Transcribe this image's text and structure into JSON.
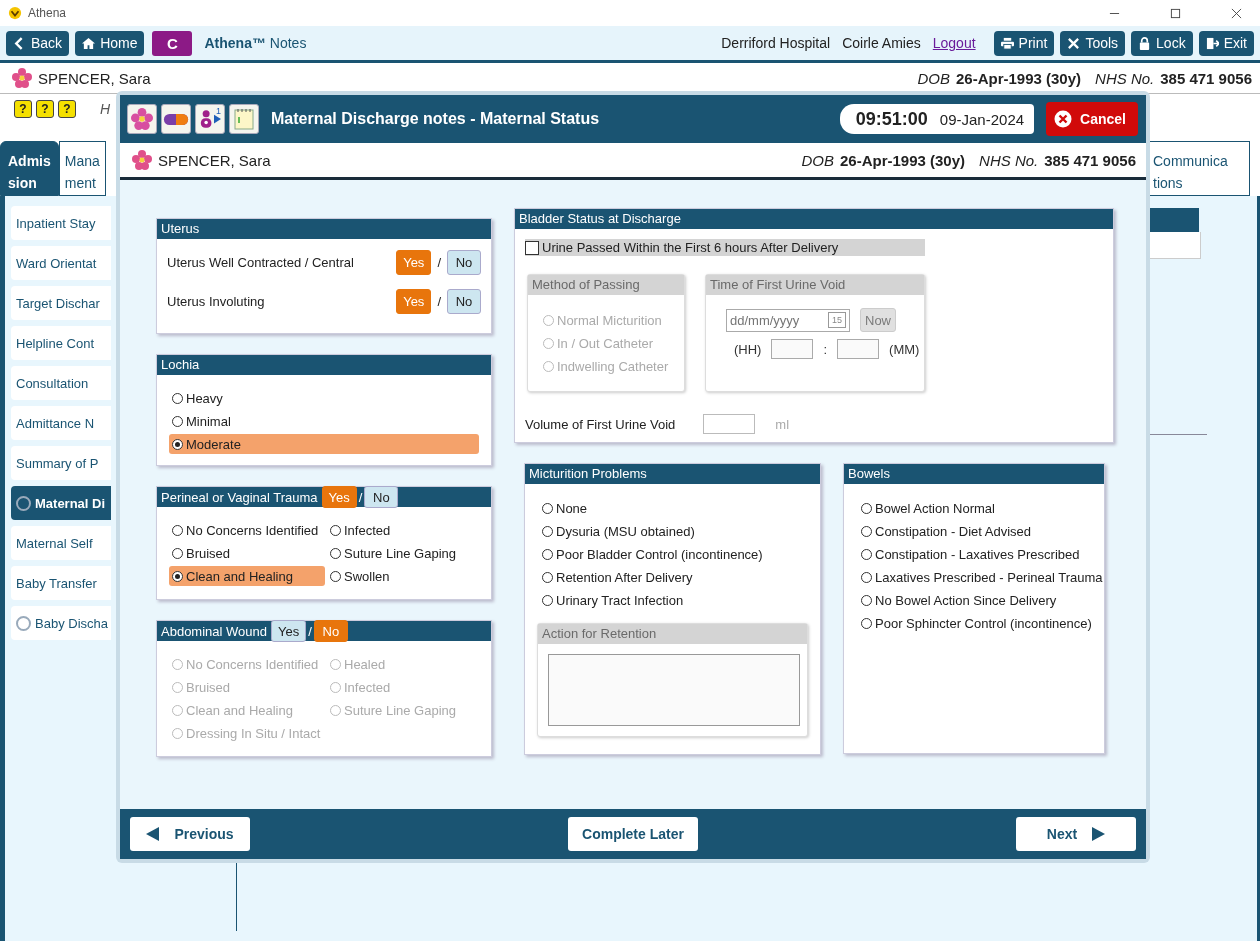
{
  "app": {
    "title": "Athena"
  },
  "toolbar": {
    "nav": [
      {
        "label": "Back"
      },
      {
        "label": "Home"
      }
    ],
    "badge": "C",
    "app_name": "**Athena™** Notes",
    "hospital": "Derriford Hospital",
    "user": "Coirle Amies",
    "logout": "Logout",
    "actions": [
      {
        "label": "Print"
      },
      {
        "label": "Tools"
      },
      {
        "label": "Lock"
      },
      {
        "label": "Exit"
      }
    ]
  },
  "patient": {
    "name": "SPENCER, Sara",
    "dob_label": "DOB",
    "dob": "26-Apr-1993 (30y)",
    "nhs_label": "NHS No.",
    "nhs": "385 471 9056"
  },
  "flags": {
    "glyphs": [
      "?",
      "?",
      "?"
    ],
    "note": "H"
  },
  "tabs": [
    {
      "lines": [
        "Admis",
        "sion"
      ],
      "selected": true
    },
    {
      "lines": [
        "Mana",
        "ment"
      ],
      "selected": false
    }
  ],
  "right_tabs": [
    {
      "lines": [
        "Communica",
        "tions"
      ],
      "selected": false
    }
  ],
  "sidebar": [
    {
      "label": "Inpatient Stay",
      "kind": "plain",
      "selected": false
    },
    {
      "label": "Ward Orientat",
      "kind": "plain",
      "selected": false
    },
    {
      "label": "Target Dischar",
      "kind": "plain",
      "selected": false
    },
    {
      "label": "Helpline Cont",
      "kind": "plain",
      "selected": false
    },
    {
      "label": "Consultation",
      "kind": "plain",
      "selected": false
    },
    {
      "label": "Admittance N",
      "kind": "plain",
      "selected": false
    },
    {
      "label": "Summary of P",
      "kind": "plain",
      "selected": false
    },
    {
      "label": "Maternal Di",
      "kind": "status",
      "selected": true
    },
    {
      "label": "Maternal Self",
      "kind": "plain",
      "selected": false
    },
    {
      "label": "Baby Transfer",
      "kind": "plain",
      "selected": false
    },
    {
      "label": "Baby Discha",
      "kind": "status",
      "selected": false
    }
  ],
  "dialog": {
    "title": "Maternal Discharge notes - Maternal Status",
    "person_count": "1",
    "time": "09:51:00",
    "date": "09-Jan-2024",
    "cancel": "Cancel",
    "patient": {
      "name": "SPENCER, Sara",
      "dob_label": "DOB",
      "dob": "26-Apr-1993 (30y)",
      "nhs_label": "NHS No.",
      "nhs": "385 471 9056"
    },
    "uterus": {
      "title": "Uterus",
      "rows": [
        {
          "label": "Uterus Well Contracted / Central",
          "separator": "/",
          "options": [
            {
              "label": "Yes",
              "selected": true
            },
            {
              "label": "No",
              "selected": false
            }
          ]
        },
        {
          "label": "Uterus Involuting",
          "separator": "/",
          "options": [
            {
              "label": "Yes",
              "selected": true
            },
            {
              "label": "No",
              "selected": false
            }
          ]
        }
      ]
    },
    "lochia": {
      "title": "Lochia",
      "options": [
        {
          "label": "Heavy",
          "selected": false
        },
        {
          "label": "Minimal",
          "selected": false
        },
        {
          "label": "Moderate",
          "selected": true
        }
      ]
    },
    "perineal": {
      "title": "Perineal or Vaginal Trauma",
      "separator": "/",
      "disabled": false,
      "toggle": [
        {
          "label": "Yes",
          "selected": true
        },
        {
          "label": "No",
          "selected": false
        }
      ],
      "options": [
        {
          "label": "No Concerns Identified",
          "selected": false
        },
        {
          "label": "Infected",
          "selected": false
        },
        {
          "label": "Bruised",
          "selected": false
        },
        {
          "label": "Suture Line Gaping",
          "selected": false
        },
        {
          "label": "Clean and Healing",
          "selected": true
        },
        {
          "label": "Swollen",
          "selected": false
        }
      ]
    },
    "abdominal": {
      "title": "Abdominal Wound",
      "separator": "/",
      "disabled": true,
      "toggle": [
        {
          "label": "Yes",
          "selected": false
        },
        {
          "label": "No",
          "selected": true
        }
      ],
      "options": [
        {
          "label": "No Concerns Identified",
          "selected": false
        },
        {
          "label": "Healed",
          "selected": false
        },
        {
          "label": "Bruised",
          "selected": false
        },
        {
          "label": "Infected",
          "selected": false
        },
        {
          "label": "Clean and Healing",
          "selected": false
        },
        {
          "label": "Suture Line Gaping",
          "selected": false
        },
        {
          "label": "Dressing In Situ / Intact",
          "selected": false
        }
      ]
    },
    "bladder": {
      "title": "Bladder Status at Discharge",
      "check": {
        "label": "Urine Passed Within the First 6 hours After Delivery",
        "checked": false
      },
      "method": {
        "title": "Method of Passing",
        "disabled": true,
        "options": [
          {
            "label": "Normal Micturition",
            "selected": false
          },
          {
            "label": "In / Out Catheter",
            "selected": false
          },
          {
            "label": "Indwelling Catheter",
            "selected": false
          }
        ]
      },
      "time": {
        "title": "Time of First Urine Void",
        "disabled": true,
        "date_placeholder": "dd/mm/yyyy",
        "calendar_day": "15",
        "now": "Now",
        "hh": "(HH)",
        "colon": ":",
        "mm": "(MM)"
      },
      "volume": {
        "label": "Volume of First Urine Void",
        "unit": "ml"
      }
    },
    "micturition": {
      "title": "Micturition Problems",
      "options": [
        {
          "label": "None",
          "selected": false
        },
        {
          "label": "Dysuria (MSU obtained)",
          "selected": false
        },
        {
          "label": "Poor Bladder Control (incontinence)",
          "selected": false
        },
        {
          "label": "Retention After Delivery",
          "selected": false
        },
        {
          "label": "Urinary Tract Infection",
          "selected": false
        }
      ],
      "action": {
        "title": "Action for Retention",
        "disabled": true
      }
    },
    "bowels": {
      "title": "Bowels",
      "options": [
        {
          "label": "Bowel Action Normal",
          "selected": false
        },
        {
          "label": "Constipation - Diet Advised",
          "selected": false
        },
        {
          "label": "Constipation - Laxatives Prescribed",
          "selected": false
        },
        {
          "label": "Laxatives Prescribed - Perineal Trauma",
          "selected": false
        },
        {
          "label": "No Bowel Action Since Delivery",
          "selected": false
        },
        {
          "label": "Poor Sphincter Control (incontinence)",
          "selected": false
        }
      ]
    },
    "footer": {
      "previous": "Previous",
      "complete": "Complete Later",
      "next": "Next"
    }
  }
}
